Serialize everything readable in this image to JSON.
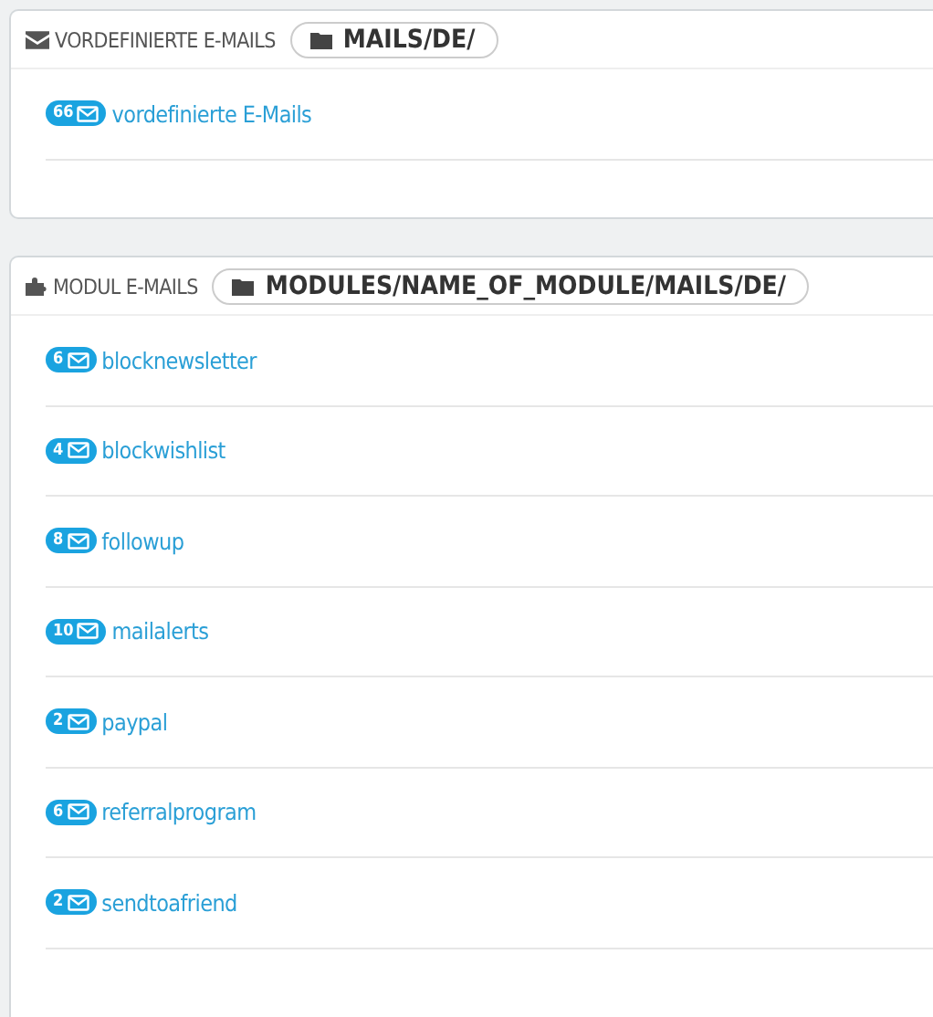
{
  "panels": [
    {
      "kind": "predefined",
      "title": "VORDEFINIERTE E-MAILS",
      "path": "MAILS/DE/",
      "items": [
        {
          "count": "66",
          "label": "vordefinierte E-Mails"
        }
      ]
    },
    {
      "kind": "module",
      "title": "MODUL E-MAILS",
      "path": "MODULES/NAME_OF_MODULE/MAILS/DE/",
      "items": [
        {
          "count": "6",
          "label": "blocknewsletter"
        },
        {
          "count": "4",
          "label": "blockwishlist"
        },
        {
          "count": "8",
          "label": "followup"
        },
        {
          "count": "10",
          "label": "mailalerts"
        },
        {
          "count": "2",
          "label": "paypal"
        },
        {
          "count": "6",
          "label": "referralprogram"
        },
        {
          "count": "2",
          "label": "sendtoafriend"
        }
      ]
    }
  ]
}
